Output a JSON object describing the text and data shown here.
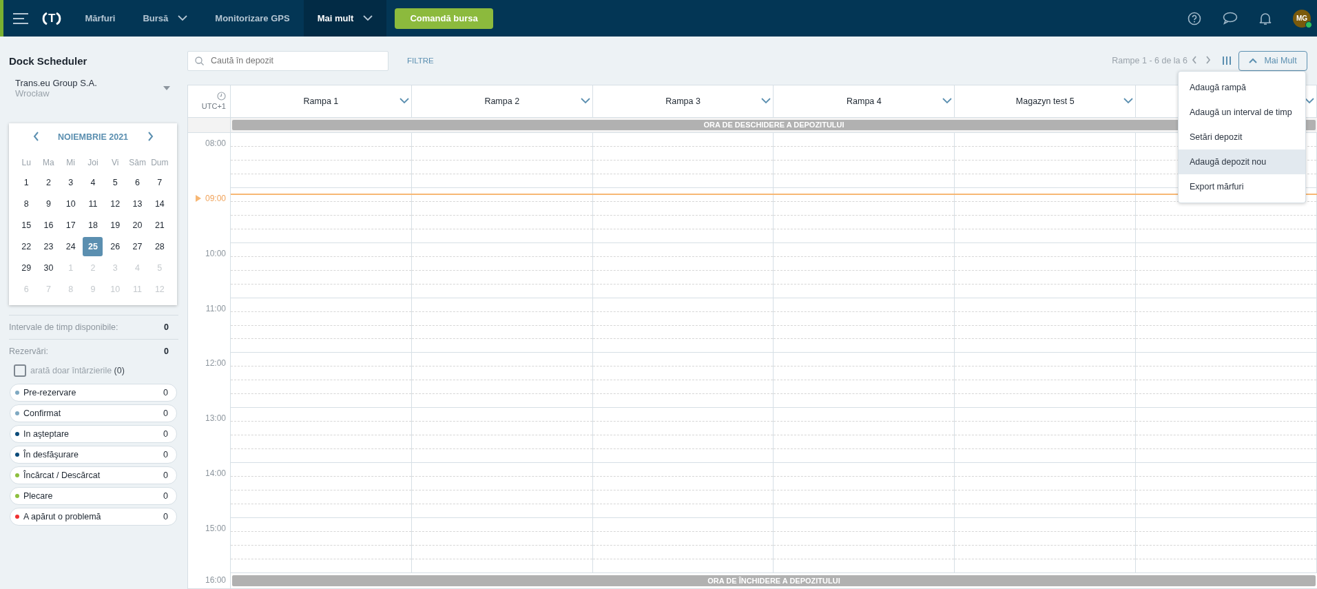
{
  "topbar": {
    "logo": {
      "letter": "T"
    },
    "nav": [
      {
        "label": "Mărfuri",
        "dropdown": false,
        "selected": false
      },
      {
        "label": "Bursă",
        "dropdown": true,
        "selected": false
      },
      {
        "label": "Monitorizare GPS",
        "dropdown": false,
        "selected": false
      },
      {
        "label": "Mai mult",
        "dropdown": true,
        "selected": true
      }
    ],
    "cta": "Comandă bursa",
    "avatar": {
      "initials": "MG",
      "online": true
    }
  },
  "sidebar": {
    "title": "Dock Scheduler",
    "warehouse": {
      "name": "Trans.eu Group S.A.",
      "city": "Wrocław"
    },
    "calendar": {
      "month": "NOIEMBRIE 2021",
      "weekdays": [
        "Lu",
        "Ma",
        "Mi",
        "Joi",
        "Vi",
        "Sâm",
        "Dum"
      ],
      "weeks": [
        [
          {
            "d": "1",
            "muted": false,
            "selected": false
          },
          {
            "d": "2",
            "muted": false,
            "selected": false
          },
          {
            "d": "3",
            "muted": false,
            "selected": false
          },
          {
            "d": "4",
            "muted": false,
            "selected": false
          },
          {
            "d": "5",
            "muted": false,
            "selected": false
          },
          {
            "d": "6",
            "muted": false,
            "selected": false
          },
          {
            "d": "7",
            "muted": false,
            "selected": false
          }
        ],
        [
          {
            "d": "8",
            "muted": false,
            "selected": false
          },
          {
            "d": "9",
            "muted": false,
            "selected": false
          },
          {
            "d": "10",
            "muted": false,
            "selected": false
          },
          {
            "d": "11",
            "muted": false,
            "selected": false
          },
          {
            "d": "12",
            "muted": false,
            "selected": false
          },
          {
            "d": "13",
            "muted": false,
            "selected": false
          },
          {
            "d": "14",
            "muted": false,
            "selected": false
          }
        ],
        [
          {
            "d": "15",
            "muted": false,
            "selected": false
          },
          {
            "d": "16",
            "muted": false,
            "selected": false
          },
          {
            "d": "17",
            "muted": false,
            "selected": false
          },
          {
            "d": "18",
            "muted": false,
            "selected": false
          },
          {
            "d": "19",
            "muted": false,
            "selected": false
          },
          {
            "d": "20",
            "muted": false,
            "selected": false
          },
          {
            "d": "21",
            "muted": false,
            "selected": false
          }
        ],
        [
          {
            "d": "22",
            "muted": false,
            "selected": false
          },
          {
            "d": "23",
            "muted": false,
            "selected": false
          },
          {
            "d": "24",
            "muted": false,
            "selected": false
          },
          {
            "d": "25",
            "muted": false,
            "selected": true
          },
          {
            "d": "26",
            "muted": false,
            "selected": false
          },
          {
            "d": "27",
            "muted": false,
            "selected": false
          },
          {
            "d": "28",
            "muted": false,
            "selected": false
          }
        ],
        [
          {
            "d": "29",
            "muted": false,
            "selected": false
          },
          {
            "d": "30",
            "muted": false,
            "selected": false
          },
          {
            "d": "1",
            "muted": true,
            "selected": false
          },
          {
            "d": "2",
            "muted": true,
            "selected": false
          },
          {
            "d": "3",
            "muted": true,
            "selected": false
          },
          {
            "d": "4",
            "muted": true,
            "selected": false
          },
          {
            "d": "5",
            "muted": true,
            "selected": false
          }
        ],
        [
          {
            "d": "6",
            "muted": true,
            "selected": false
          },
          {
            "d": "7",
            "muted": true,
            "selected": false
          },
          {
            "d": "8",
            "muted": true,
            "selected": false
          },
          {
            "d": "9",
            "muted": true,
            "selected": false
          },
          {
            "d": "10",
            "muted": true,
            "selected": false
          },
          {
            "d": "11",
            "muted": true,
            "selected": false
          },
          {
            "d": "12",
            "muted": true,
            "selected": false
          }
        ]
      ]
    },
    "stats": [
      {
        "label": "Intervale de timp disponibile:",
        "value": "0"
      },
      {
        "label": "Rezervări:",
        "value": "0"
      }
    ],
    "delays_filter": {
      "label": "arată doar întârzierile",
      "count": "(0)",
      "checked": false
    },
    "statuses": [
      {
        "label": "Pre-rezervare",
        "count": "0",
        "color": "#7fa9c2"
      },
      {
        "label": "Confirmat",
        "count": "0",
        "color": "#7fa9c2"
      },
      {
        "label": "In aşteptare",
        "count": "0",
        "color": "#0b4b7a"
      },
      {
        "label": "În desfăşurare",
        "count": "0",
        "color": "#0b4b7a"
      },
      {
        "label": "Încărcat / Descărcat",
        "count": "0",
        "color": "#8dbf3e"
      },
      {
        "label": "Plecare",
        "count": "0",
        "color": "#8dbf3e"
      },
      {
        "label": "A apărut o problemă",
        "count": "0",
        "color": "#f03030"
      }
    ]
  },
  "toolbar": {
    "search": {
      "placeholder": "Caută în depozit"
    },
    "filters": "FILTRE",
    "pager": "Rampe 1 - 6 de la 6",
    "more": "Mai Mult",
    "menu": [
      {
        "label": "Adaugă rampă",
        "highlighted": false
      },
      {
        "label": "Adaugă un interval de timp",
        "highlighted": false
      },
      {
        "label": "Setări depozit",
        "highlighted": false
      },
      {
        "label": "Adaugă depozit nou",
        "highlighted": true
      },
      {
        "label": "Export mărfuri",
        "highlighted": false
      }
    ]
  },
  "schedule": {
    "timezone": "UTC+1",
    "columns": [
      {
        "name": "Rampa 1"
      },
      {
        "name": "Rampa 2"
      },
      {
        "name": "Rampa 3"
      },
      {
        "name": "Rampa 4"
      },
      {
        "name": "Magazyn test 5"
      },
      {}
    ],
    "opening_band": "ORA DE DESCHIDERE A DEPOZITULUI",
    "hours": [
      {
        "label": "08:00",
        "current": false
      },
      {
        "label": "09:00",
        "current": true
      },
      {
        "label": "10:00",
        "current": false
      },
      {
        "label": "11:00",
        "current": false
      },
      {
        "label": "12:00",
        "current": false
      },
      {
        "label": "13:00",
        "current": false
      },
      {
        "label": "14:00",
        "current": false
      },
      {
        "label": "15:00",
        "current": false
      }
    ],
    "closing_hour": "16:00",
    "closing_band": "ORA DE ÎNCHIDERE A DEPOZITULUI"
  }
}
